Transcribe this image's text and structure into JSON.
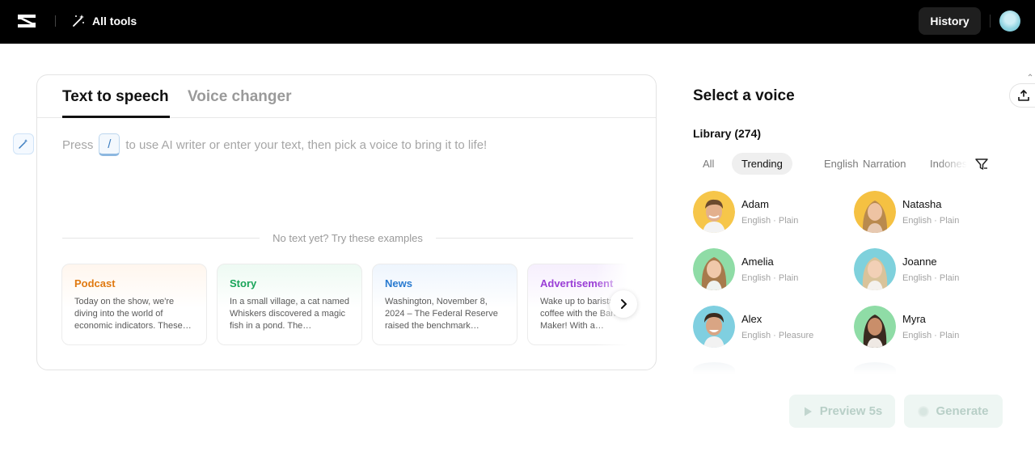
{
  "header": {
    "all_tools_label": "All tools",
    "history_label": "History"
  },
  "editor": {
    "tabs": [
      {
        "label": "Text to speech",
        "active": true
      },
      {
        "label": "Voice changer",
        "active": false
      }
    ],
    "prompt_before": "Press",
    "prompt_key": "/",
    "prompt_after": "to use AI writer or enter your text, then pick a voice to bring it to life!",
    "examples_heading": "No text yet? Try these examples",
    "examples": [
      {
        "title": "Podcast",
        "text": "Today on the show, we're diving into the world of economic indicators. These…"
      },
      {
        "title": "Story",
        "text": "In a small village, a cat named Whiskers discovered a magic fish in a pond. The…"
      },
      {
        "title": "News",
        "text": "Washington, November 8, 2024 – The Federal Reserve raised the benchmark…"
      },
      {
        "title": "Advertisement",
        "text": "Wake up to barista-quality coffee with the Barista Coffee Maker! With a…"
      }
    ]
  },
  "voices_panel": {
    "title": "Select a voice",
    "library_label": "Library (274)",
    "filters": [
      {
        "label": "All",
        "selected": false
      },
      {
        "label": "Trending",
        "selected": true
      },
      {
        "label": "English",
        "selected": false
      },
      {
        "label": "Narration",
        "selected": false
      },
      {
        "label": "Indonesian",
        "selected": false
      }
    ],
    "voices": [
      {
        "name": "Adam",
        "meta": "English · Plain"
      },
      {
        "name": "Natasha",
        "meta": "English · Plain"
      },
      {
        "name": "Amelia",
        "meta": "English · Plain"
      },
      {
        "name": "Joanne",
        "meta": "English · Plain"
      },
      {
        "name": "Alex",
        "meta": "English · Pleasure"
      },
      {
        "name": "Myra",
        "meta": "English · Plain"
      }
    ],
    "preview_label": "Preview 5s",
    "generate_label": "Generate"
  },
  "colors": {
    "topbar": "#000000",
    "podcast": "#e07a12",
    "story": "#1aa55a",
    "news": "#2a7bd0",
    "advertisement": "#9a3fd6"
  }
}
